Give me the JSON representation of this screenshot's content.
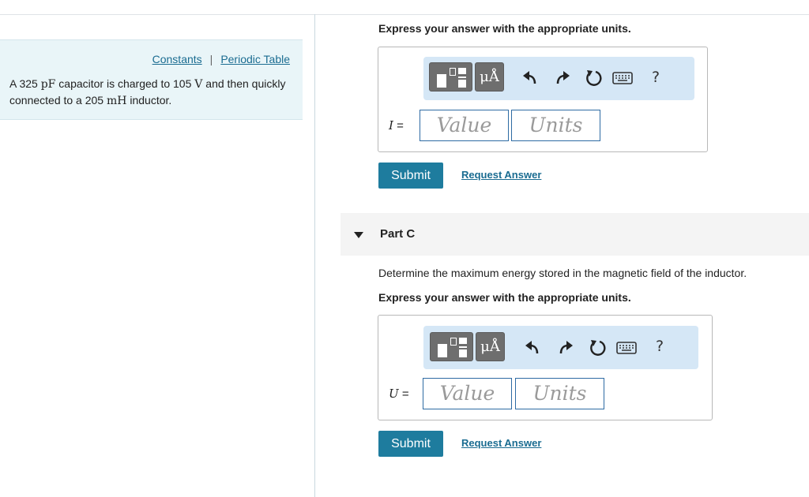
{
  "left_panel": {
    "links": {
      "constants": "Constants",
      "separator": "|",
      "periodic_table": "Periodic Table"
    },
    "problem": {
      "p1": "A 325 ",
      "unit_pf": "pF",
      "p2": " capacitor is charged to 105 ",
      "unit_v": "V",
      "p3": " and then quickly connected to a 205 ",
      "unit_mh": "mH",
      "p4": " inductor."
    }
  },
  "part_b": {
    "instruction": "Express your answer with the appropriate units.",
    "toolbar": {
      "units_label": "μÅ",
      "help_label": "?"
    },
    "variable": "I",
    "equals": " =",
    "value_placeholder": "Value",
    "units_placeholder": "Units",
    "submit_label": "Submit",
    "request_answer_label": "Request Answer"
  },
  "part_c": {
    "title": "Part C",
    "question": "Determine the maximum energy stored in the magnetic field of the inductor.",
    "instruction": "Express your answer with the appropriate units.",
    "toolbar": {
      "units_label": "μÅ",
      "help_label": "?"
    },
    "variable": "U",
    "equals": " =",
    "value_placeholder": "Value",
    "units_placeholder": "Units",
    "submit_label": "Submit",
    "request_answer_label": "Request Answer"
  },
  "colors": {
    "accent": "#1e7c9e",
    "link": "#1a6c91",
    "toolbar_bg": "#d5e7f6",
    "panel_bg": "#e9f5f8"
  }
}
